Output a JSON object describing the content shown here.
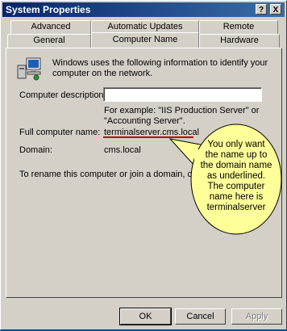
{
  "window": {
    "title": "System Properties",
    "help_btn": "?",
    "close_btn": "X"
  },
  "tabs_back": [
    "Advanced",
    "Automatic Updates",
    "Remote"
  ],
  "tabs_front": [
    "General",
    "Computer Name",
    "Hardware"
  ],
  "active_tab": "Computer Name",
  "panel": {
    "intro": "Windows uses the following information to identify your computer on the network.",
    "description_label": "Computer description:",
    "description_value": "",
    "example_text": "For example: \"IIS Production Server\" or \"Accounting Server\".",
    "full_name_label": "Full computer name:",
    "full_name_value": "terminalserver.cms.local",
    "domain_label": "Domain:",
    "domain_value": "cms.local",
    "rename_text": "To rename this computer or join a domain, clic"
  },
  "callout": {
    "text": "You only want the name up to the domain name as underlined.  The computer name here is terminalserver",
    "fill": "#ffff99",
    "underline_color": "#c00000"
  },
  "buttons": {
    "ok": "OK",
    "cancel": "Cancel",
    "apply": "Apply"
  },
  "icons": {
    "computer": "computer-network-icon"
  }
}
